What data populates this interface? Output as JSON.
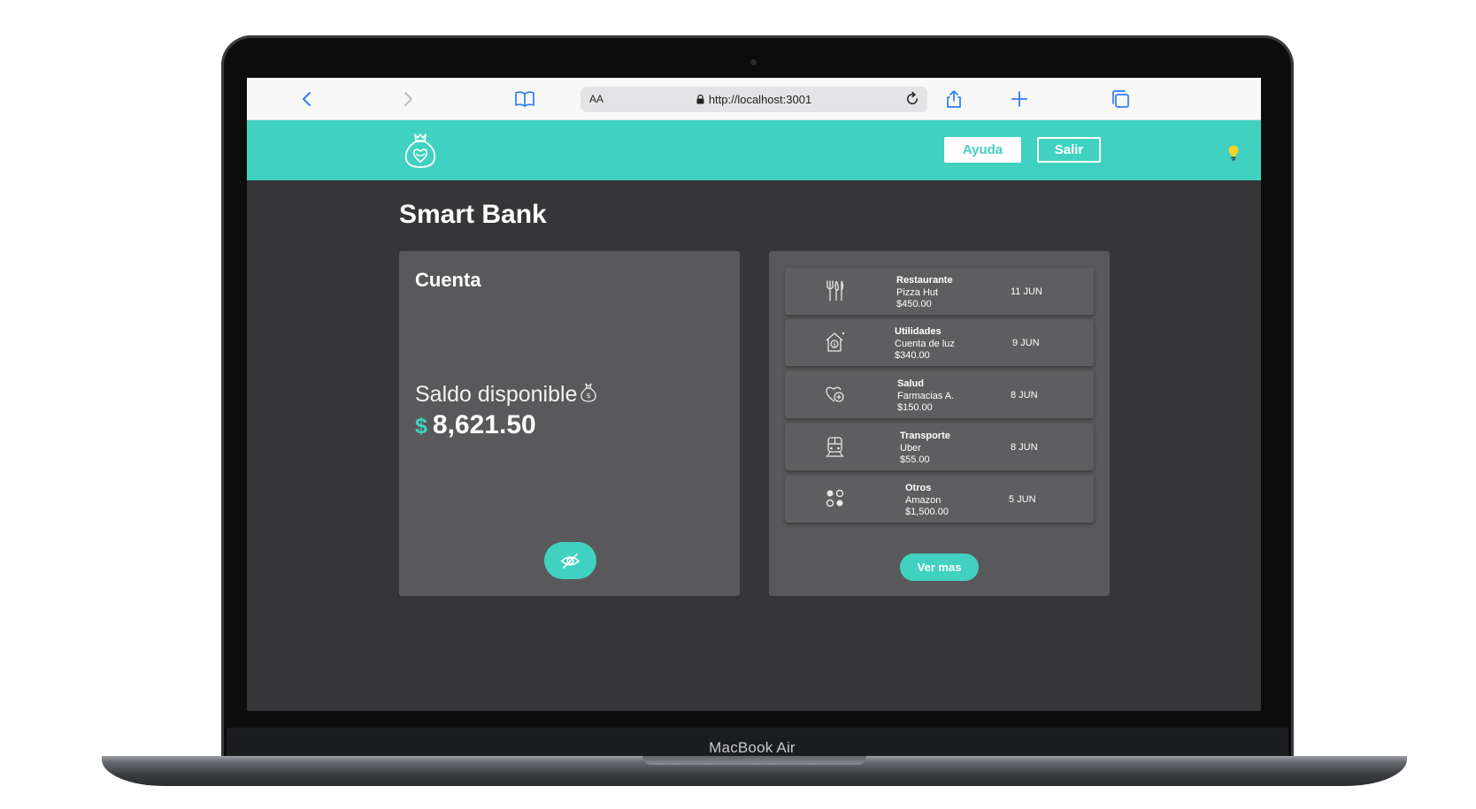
{
  "device": {
    "label": "MacBook Air"
  },
  "browser": {
    "url_prefix": "AA",
    "url": "http://localhost:3001"
  },
  "header": {
    "help_label": "Ayuda",
    "logout_label": "Salir"
  },
  "page": {
    "title": "Smart Bank"
  },
  "account": {
    "title": "Cuenta",
    "balance_label": "Saldo disponible",
    "currency_symbol": "$",
    "balance": "8,621.50"
  },
  "transactions": [
    {
      "category": "Restaurante",
      "merchant": "Pizza Hut",
      "amount": "$450.00",
      "date": "11 JUN",
      "icon": "utensils-icon"
    },
    {
      "category": "Utilidades",
      "merchant": "Cuenta de luz",
      "amount": "$340.00",
      "date": "9 JUN",
      "icon": "house-bill-icon"
    },
    {
      "category": "Salud",
      "merchant": "Farmacias A.",
      "amount": "$150.00",
      "date": "8 JUN",
      "icon": "heart-health-icon"
    },
    {
      "category": "Transporte",
      "merchant": "Uber",
      "amount": "$55.00",
      "date": "8 JUN",
      "icon": "train-icon"
    },
    {
      "category": "Otros",
      "merchant": "Amazon",
      "amount": "$1,500.00",
      "date": "5 JUN",
      "icon": "dots-grid-icon"
    }
  ],
  "see_more_label": "Ver mas",
  "colors": {
    "accent": "#41d1c0",
    "background": "#363638",
    "card": "#59595b"
  }
}
